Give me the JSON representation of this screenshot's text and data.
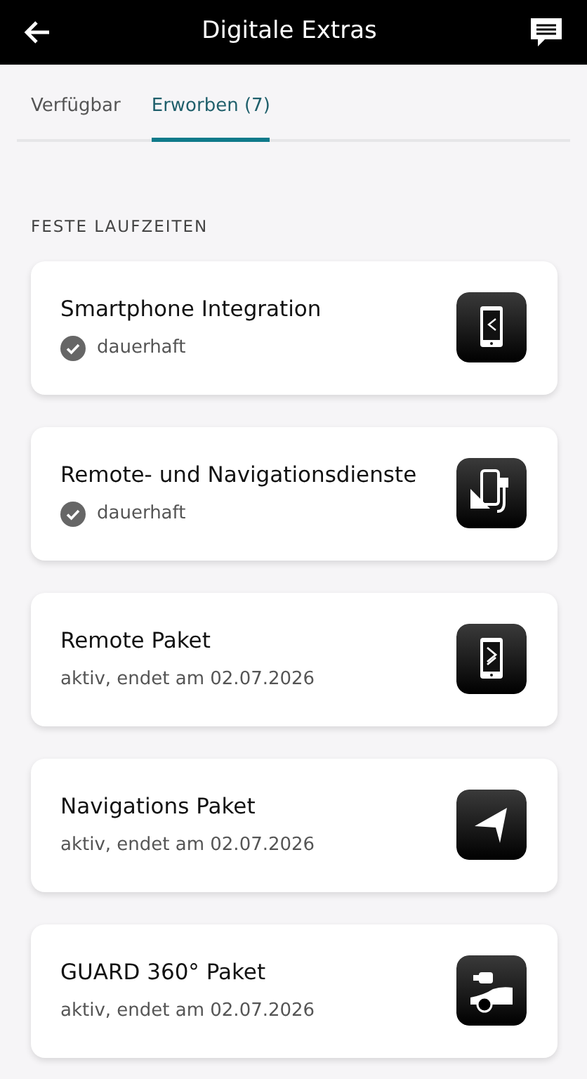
{
  "header": {
    "title": "Digitale Extras"
  },
  "tabs": [
    {
      "label": "Verfügbar",
      "selected": false
    },
    {
      "label": "Erworben (7)",
      "selected": true
    }
  ],
  "section_title": "FESTE LAUFZEITEN",
  "products": [
    {
      "kind": "permanent",
      "title": "Smartphone Integration",
      "status": "dauerhaft"
    },
    {
      "kind": "permanent",
      "title": "Remote- und Navigationsdienste",
      "status": "dauerhaft"
    },
    {
      "kind": "timed",
      "title": "Remote Paket",
      "status": "aktiv, endet am 02.07.2026"
    },
    {
      "kind": "timed",
      "title": "Navigations Paket",
      "status": "aktiv, endet am 02.07.2026"
    },
    {
      "kind": "timed",
      "title": "GUARD 360° Paket",
      "status": "aktiv, endet am 02.07.2026"
    }
  ]
}
